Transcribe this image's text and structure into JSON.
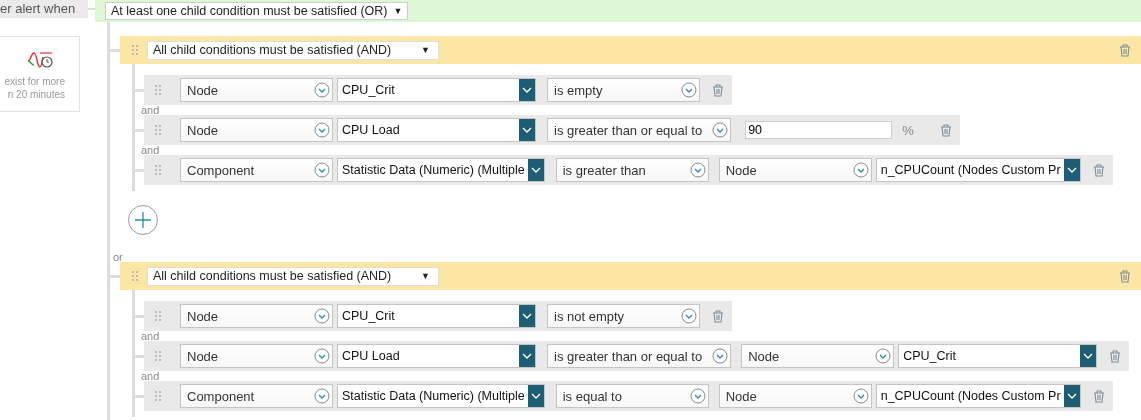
{
  "sidebar": {
    "header": "er alert when",
    "card": {
      "lines": [
        "exist for more",
        "n 20 minutes"
      ]
    }
  },
  "root_condition": {
    "label": "At least one child condition must be satisfied (OR)",
    "caret": "▼"
  },
  "groups": [
    {
      "label": "All child conditions must be satisfied (AND)",
      "caret": "▼",
      "add_button": true,
      "conditions": [
        {
          "entity": "Node",
          "property": "CPU_Crit",
          "operator": "is empty"
        },
        {
          "connector": "and",
          "entity": "Node",
          "property": "CPU Load",
          "operator": "is greater than or equal to",
          "compare": {
            "kind": "value",
            "value": "90",
            "unit": "%"
          }
        },
        {
          "connector": "and",
          "entity": "Component",
          "property": "Statistic Data (Numeric) (Multiple",
          "operator": "is greater than",
          "compare": {
            "kind": "field",
            "entity": "Node",
            "property": "n_CPUCount (Nodes Custom Pr"
          }
        }
      ]
    },
    {
      "connector": "or",
      "label": "All child conditions must be satisfied (AND)",
      "caret": "▼",
      "conditions": [
        {
          "entity": "Node",
          "property": "CPU_Crit",
          "operator": "is not empty"
        },
        {
          "connector": "and",
          "entity": "Node",
          "property": "CPU Load",
          "operator": "is greater than or equal to",
          "compare": {
            "kind": "field",
            "entity": "Node",
            "property": "CPU_Crit"
          }
        },
        {
          "connector": "and",
          "entity": "Component",
          "property": "Statistic Data (Numeric) (Multiple",
          "operator": "is equal to",
          "compare": {
            "kind": "field",
            "entity": "Node",
            "property": "n_CPUCount (Nodes Custom Pr"
          }
        }
      ]
    }
  ]
}
